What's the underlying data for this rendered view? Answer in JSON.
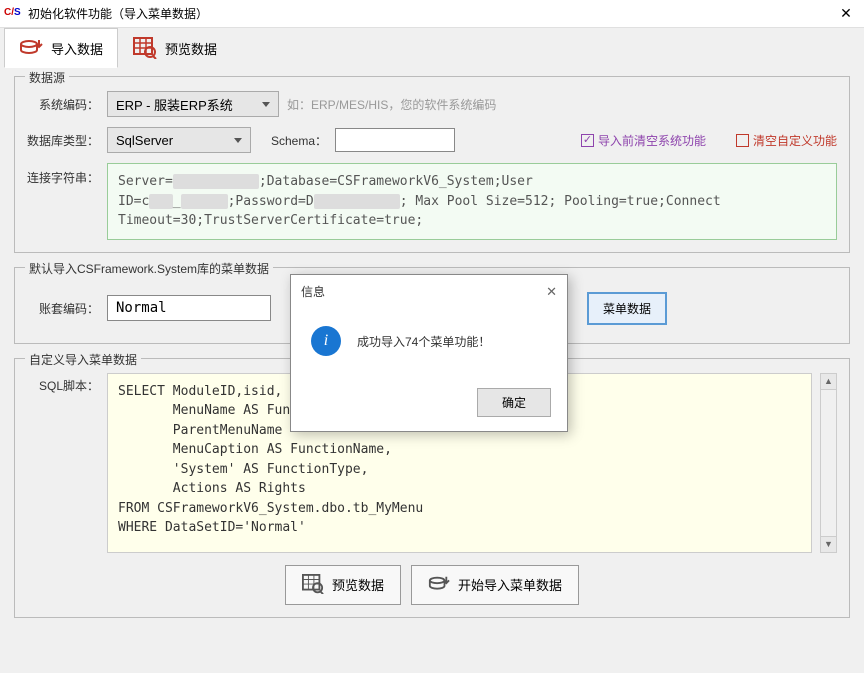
{
  "window": {
    "title": "初始化软件功能（导入菜单数据）"
  },
  "tabs": {
    "import": "导入数据",
    "preview": "预览数据"
  },
  "section_datasource": {
    "legend": "数据源",
    "syscode_label": "系统编码：",
    "syscode_value": "ERP - 服装ERP系统",
    "syscode_hint": "如：ERP/MES/HIS，您的软件系统编码",
    "dbtype_label": "数据库类型：",
    "dbtype_value": "SqlServer",
    "schema_label": "Schema：",
    "schema_value": "",
    "chk_clear_sys": "导入前清空系统功能",
    "chk_clear_custom": "清空自定义功能",
    "conn_label": "连接字符串：",
    "conn_text": "Server=███████████;Database=CSFrameworkV6_System;User\nID=c███_██████;Password=D███████████; Max Pool Size=512; Pooling=true;Connect\nTimeout=30;TrustServerCertificate=true;"
  },
  "section_default": {
    "legend": "默认导入CSFramework.System库的菜单数据",
    "account_label": "账套编码：",
    "account_value": "Normal",
    "btn_import_menu": "菜单数据"
  },
  "section_custom": {
    "legend": "自定义导入菜单数据",
    "sql_label": "SQL脚本：",
    "sql_text": "SELECT ModuleID,isid,\n       MenuName AS Fun\n       ParentMenuName \n       MenuCaption AS FunctionName,\n       'System' AS FunctionType,\n       Actions AS Rights\nFROM CSFrameworkV6_System.dbo.tb_MyMenu\nWHERE DataSetID='Normal'"
  },
  "bottom": {
    "btn_preview": "预览数据",
    "btn_start_import": "开始导入菜单数据"
  },
  "modal": {
    "title": "信息",
    "message": "成功导入74个菜单功能！",
    "ok": "确定"
  },
  "chart_data": null
}
